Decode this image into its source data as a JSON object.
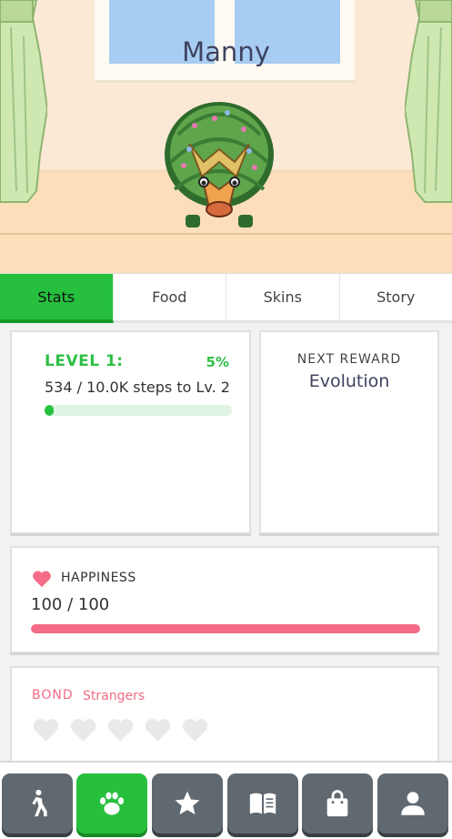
{
  "pet": {
    "name": "Manny"
  },
  "tabs": [
    {
      "label": "Stats",
      "active": true
    },
    {
      "label": "Food",
      "active": false
    },
    {
      "label": "Skins",
      "active": false
    },
    {
      "label": "Story",
      "active": false
    }
  ],
  "level": {
    "title": "LEVEL 1:",
    "percent_label": "5%",
    "progress": 0.05,
    "steps_text": "534 / 10.0K steps to Lv. 2"
  },
  "reward": {
    "label": "NEXT REWARD",
    "value": "Evolution"
  },
  "happiness": {
    "label": "HAPPINESS",
    "value_text": "100 / 100",
    "progress": 1.0,
    "icon": "heart-icon"
  },
  "bond": {
    "label": "BOND",
    "value": "Strangers",
    "hearts_total": 5,
    "hearts_filled": 0
  },
  "nav": [
    {
      "icon": "walk-icon",
      "active": false
    },
    {
      "icon": "paw-icon",
      "active": true
    },
    {
      "icon": "star-icon",
      "active": false
    },
    {
      "icon": "book-icon",
      "active": false
    },
    {
      "icon": "shop-bag-icon",
      "active": false
    },
    {
      "icon": "profile-icon",
      "active": false
    }
  ],
  "colors": {
    "accent": "#26c03e",
    "happiness": "#f56c89",
    "bond": "#f16b86",
    "nav_button": "#606870"
  }
}
